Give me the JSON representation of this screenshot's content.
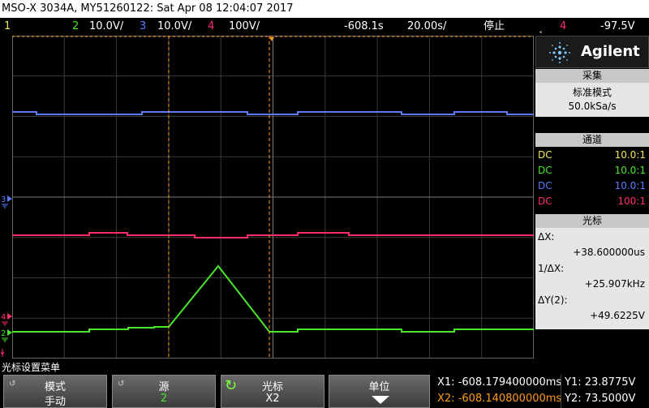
{
  "title": "MSO-X 3034A, MY51260122: Sat Apr 08 12:04:07 2017",
  "status": {
    "ch1": "1",
    "ch2": "2",
    "ch2_scale": "10.0V/",
    "ch3": "3",
    "ch3_scale": "10.0V/",
    "ch4": "4",
    "ch4_scale": "100V/",
    "delay": "-608.1s",
    "timebase": "20.00s/",
    "run_state": "停止",
    "trig_icon": "trigger-edge-icon",
    "trig_ch": "4",
    "trig_level": "-97.5V"
  },
  "colors": {
    "ch1": "#f5e85a",
    "ch2": "#49e82c",
    "ch3": "#5b7bff",
    "ch4": "#ff2e6a",
    "cursor": "#ff9a1a"
  },
  "logo": {
    "brand": "Agilent"
  },
  "acq": {
    "header": "采集",
    "mode": "标准模式",
    "rate": "50.0kSa/s"
  },
  "channels": {
    "header": "通道",
    "rows": [
      {
        "coupling": "DC",
        "probe": "10.0:1"
      },
      {
        "coupling": "DC",
        "probe": "10.0:1"
      },
      {
        "coupling": "DC",
        "probe": "10.0:1"
      },
      {
        "coupling": "DC",
        "probe": "100:1"
      }
    ]
  },
  "cursors": {
    "header": "光标",
    "dx_label": "ΔX:",
    "dx_value": "+38.600000us",
    "inv_label": "1/ΔX:",
    "inv_value": "+25.907kHz",
    "dy_label": "ΔY(2):",
    "dy_value": "+49.6225V"
  },
  "menu": {
    "title": "光标设置菜单",
    "keys": [
      {
        "top": "模式",
        "bottom": "手动"
      },
      {
        "top": "源",
        "bottom": "2"
      },
      {
        "top": "光标",
        "bottom": "X2"
      },
      {
        "top": "单位",
        "bottom": ""
      }
    ]
  },
  "readout": {
    "x1": "X1: -608.179400000ms",
    "x2": "X2: -608.140800000ms",
    "y1": "Y1: 23.8775V",
    "y2": "Y2: 73.5000V"
  }
}
